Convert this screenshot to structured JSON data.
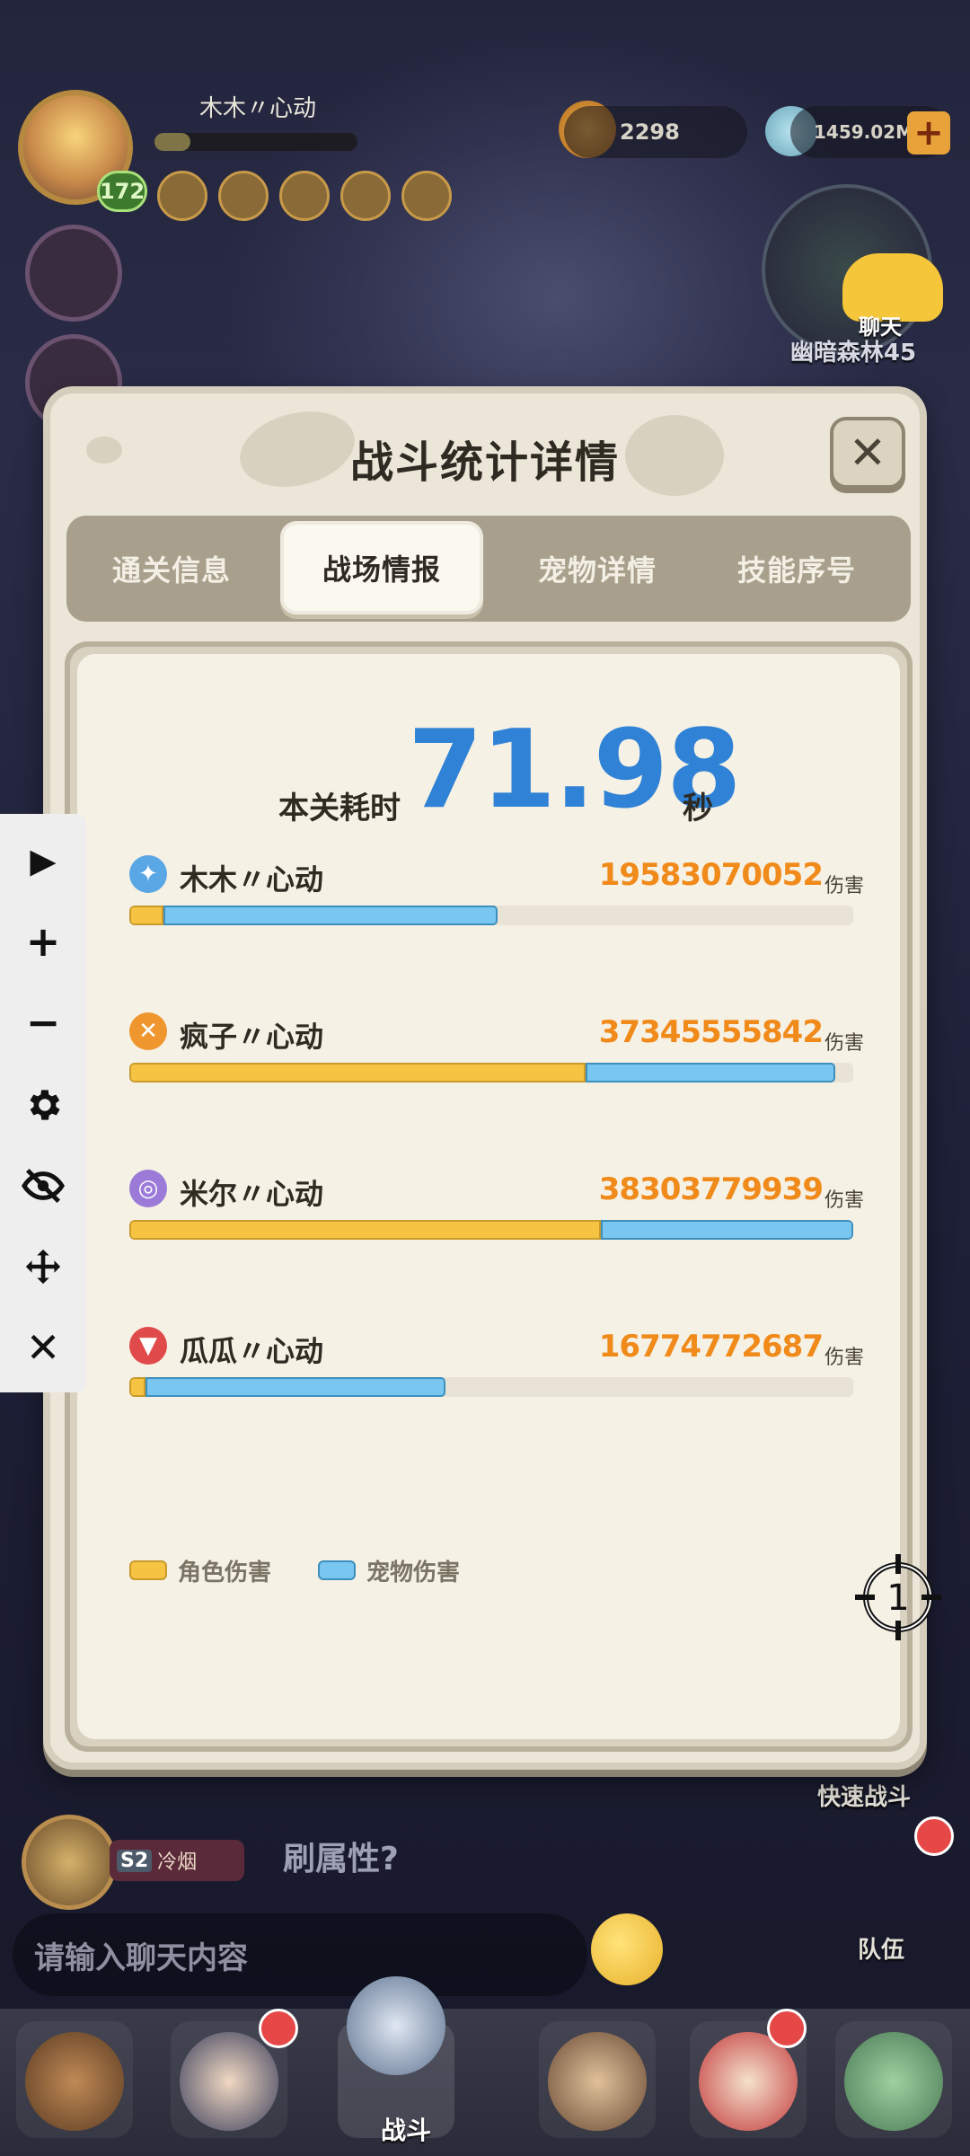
{
  "hud": {
    "player_name": "木木〃心动",
    "level": "172",
    "resource_shells": "2298",
    "resource_gems": "1459.02M",
    "plus_label": "+",
    "map_name": "幽暗森林45",
    "chat_button_label": "聊天"
  },
  "background": {
    "quick_battle_label": "快速战斗",
    "team_label": "队伍",
    "chat_tag_season": "S2",
    "chat_tag_text": "冷烟",
    "chat_message": "刷属性?",
    "chat_input_placeholder": "请输入聊天内容",
    "nav_battle_label": "战斗"
  },
  "toolbar": {
    "play_icon": "▶",
    "zoom_in_icon": "+",
    "zoom_out_icon": "−",
    "close_icon": "✕"
  },
  "modal": {
    "title": "战斗统计详情",
    "close_icon": "✕",
    "tabs": [
      {
        "label": "通关信息",
        "active": false
      },
      {
        "label": "战场情报",
        "active": true
      },
      {
        "label": "宠物详情",
        "active": false
      },
      {
        "label": "技能序号",
        "active": false
      }
    ],
    "time_label": "本关耗时",
    "time_value": "71.98",
    "time_unit": "秒",
    "damage_unit": "伤害",
    "players": [
      {
        "name": "木木〃心动",
        "damage": "19583070052",
        "icon": "ice-swirl-icon",
        "icon_color": "#5aa7e6",
        "role_fraction": 0.047,
        "pet_fraction": 0.462
      },
      {
        "name": "疯子〃心动",
        "damage": "37345555842",
        "icon": "crossed-blades-icon",
        "icon_color": "#f0962e",
        "role_fraction": 0.63,
        "pet_fraction": 0.345
      },
      {
        "name": "米尔〃心动",
        "damage": "38303779939",
        "icon": "purple-swirl-icon",
        "icon_color": "#9b7ad8",
        "role_fraction": 0.651,
        "pet_fraction": 0.349
      },
      {
        "name": "瓜瓜〃心动",
        "damage": "16774772687",
        "icon": "red-fang-icon",
        "icon_color": "#e04a4a",
        "role_fraction": 0.022,
        "pet_fraction": 0.415
      }
    ],
    "legend": {
      "role_label": "角色伤害",
      "pet_label": "宠物伤害",
      "role_color": "#f6c442",
      "pet_color": "#79c6f0"
    }
  }
}
